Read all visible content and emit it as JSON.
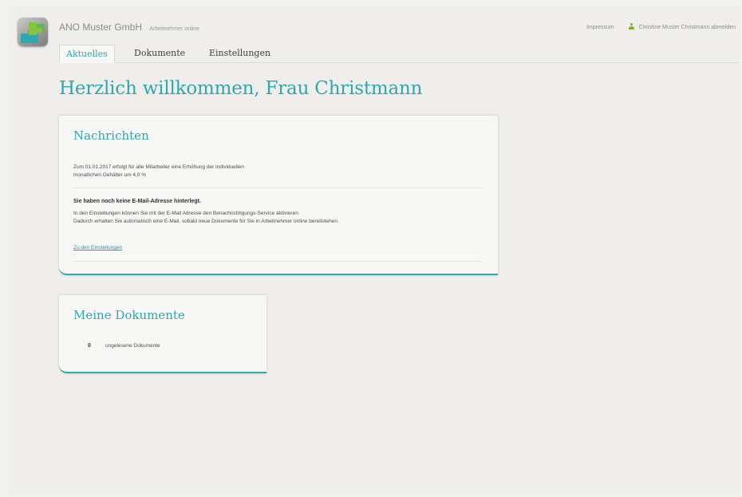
{
  "header": {
    "company": "ANO Muster GmbH",
    "app_name": "Arbeitnehmer online",
    "impressum": "Impressum",
    "user_logout": "Christine Muster Christmann abmelden",
    "logo_icon": "puzzle-icon",
    "user_icon": "user-icon"
  },
  "tabs": [
    {
      "label": "Aktuelles",
      "active": true
    },
    {
      "label": "Dokumente",
      "active": false
    },
    {
      "label": "Einstellungen",
      "active": false
    }
  ],
  "main": {
    "welcome": "Herzlich willkommen, Frau Christmann"
  },
  "news": {
    "title": "Nachrichten",
    "message1_line1": "Zum 01.01.2017 erfolgt für alle Mitarbeiter eine Erhöhung der individuellen",
    "message1_line2": "monatlichen Gehälter um 4,0 %",
    "notice_title": "Sie haben noch keine E-Mail-Adresse hinterlegt.",
    "notice_line1": "In den Einstellungen können Sie mit der E-Mail Adresse den Benachrichtigungs-Service aktivieren.",
    "notice_line2": "Dadurch erhalten Sie automatisch eine E-Mail, sobald neue Dokumente für Sie in Arbeitnehmer online bereitstehen.",
    "settings_link": "Zu den Einstellungen"
  },
  "documents": {
    "title": "Meine Dokumente",
    "unread_count": "0",
    "unread_label": "ungelesene Dokumente"
  },
  "colors": {
    "accent": "#2fa7ae",
    "background": "#efeeeb",
    "card": "#f7f7f5",
    "user_icon": "#7fae2c"
  }
}
